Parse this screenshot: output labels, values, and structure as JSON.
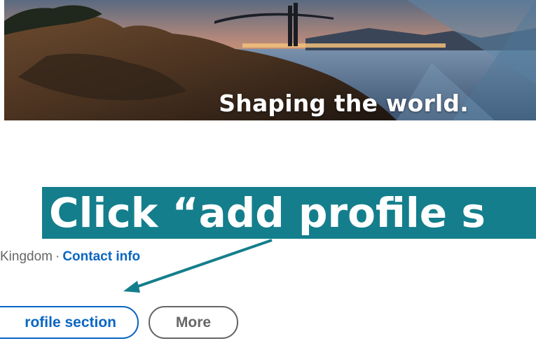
{
  "banner": {
    "tagline": "Shaping the world."
  },
  "callout": {
    "text": "Click “add profile s",
    "color": "#147e8c"
  },
  "profile": {
    "location": "Kingdom",
    "separator": "·",
    "contact_info": "Contact info"
  },
  "actions": {
    "add_section_label": "rofile section",
    "more_label": "More"
  },
  "colors": {
    "link_blue": "#0a66c2",
    "muted_gray": "#666666",
    "callout_teal": "#147e8c"
  }
}
